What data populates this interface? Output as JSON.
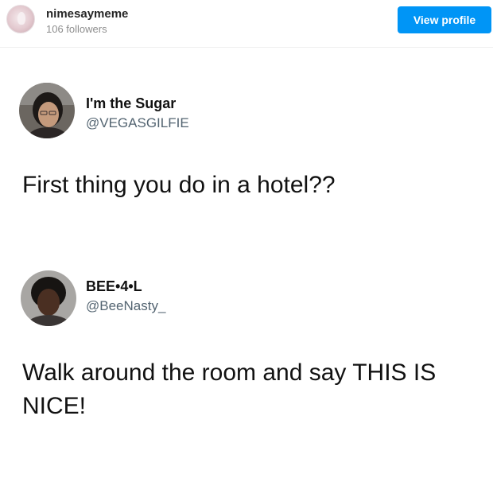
{
  "embed": {
    "username": "nimesaymeme",
    "followers": "106 followers",
    "view_profile_label": "View profile",
    "accent_color": "#0095f6"
  },
  "tweets": [
    {
      "display_name": "I'm the Sugar",
      "handle": "@VEGASGILFIE",
      "text": "First thing you do in a hotel??"
    },
    {
      "display_name": "BEE•4•L",
      "handle": "@BeeNasty_",
      "text": "Walk around the room and say THIS IS NICE!"
    }
  ]
}
